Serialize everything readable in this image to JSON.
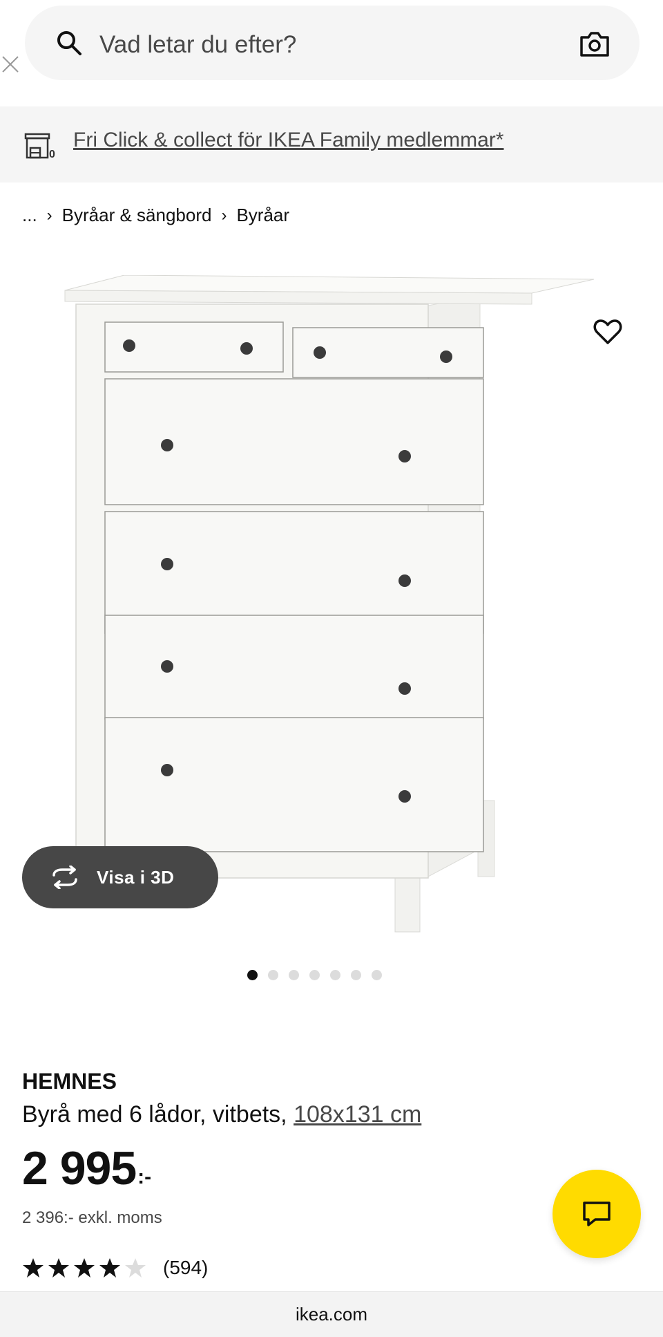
{
  "search": {
    "placeholder": "Vad letar du efter?"
  },
  "promo": {
    "text": "Fri Click & collect för IKEA Family medlemmar*"
  },
  "breadcrumb": {
    "ellipsis": "...",
    "items": [
      "Byråar & sängbord",
      "Byråar"
    ]
  },
  "media": {
    "view_3d_label": "Visa i 3D",
    "carousel_total": 7,
    "carousel_active": 1
  },
  "product": {
    "name": "HEMNES",
    "description": "Byrå med 6 lådor, vitbets, ",
    "size": "108x131 cm",
    "price_main": "2 995",
    "price_suffix": ":-",
    "price_excl_vat": "2 396:- exkl. moms",
    "rating_value": 4.5,
    "rating_count": "(594)"
  },
  "browser": {
    "url": "ikea.com"
  },
  "colors": {
    "accent_yellow": "#ffdb00",
    "dark_pill": "#474747",
    "surface": "#f5f5f5"
  },
  "icons": [
    "search-icon",
    "camera-icon",
    "close-icon",
    "store-icon",
    "favorite-icon",
    "rotate-icon",
    "chat-icon"
  ]
}
